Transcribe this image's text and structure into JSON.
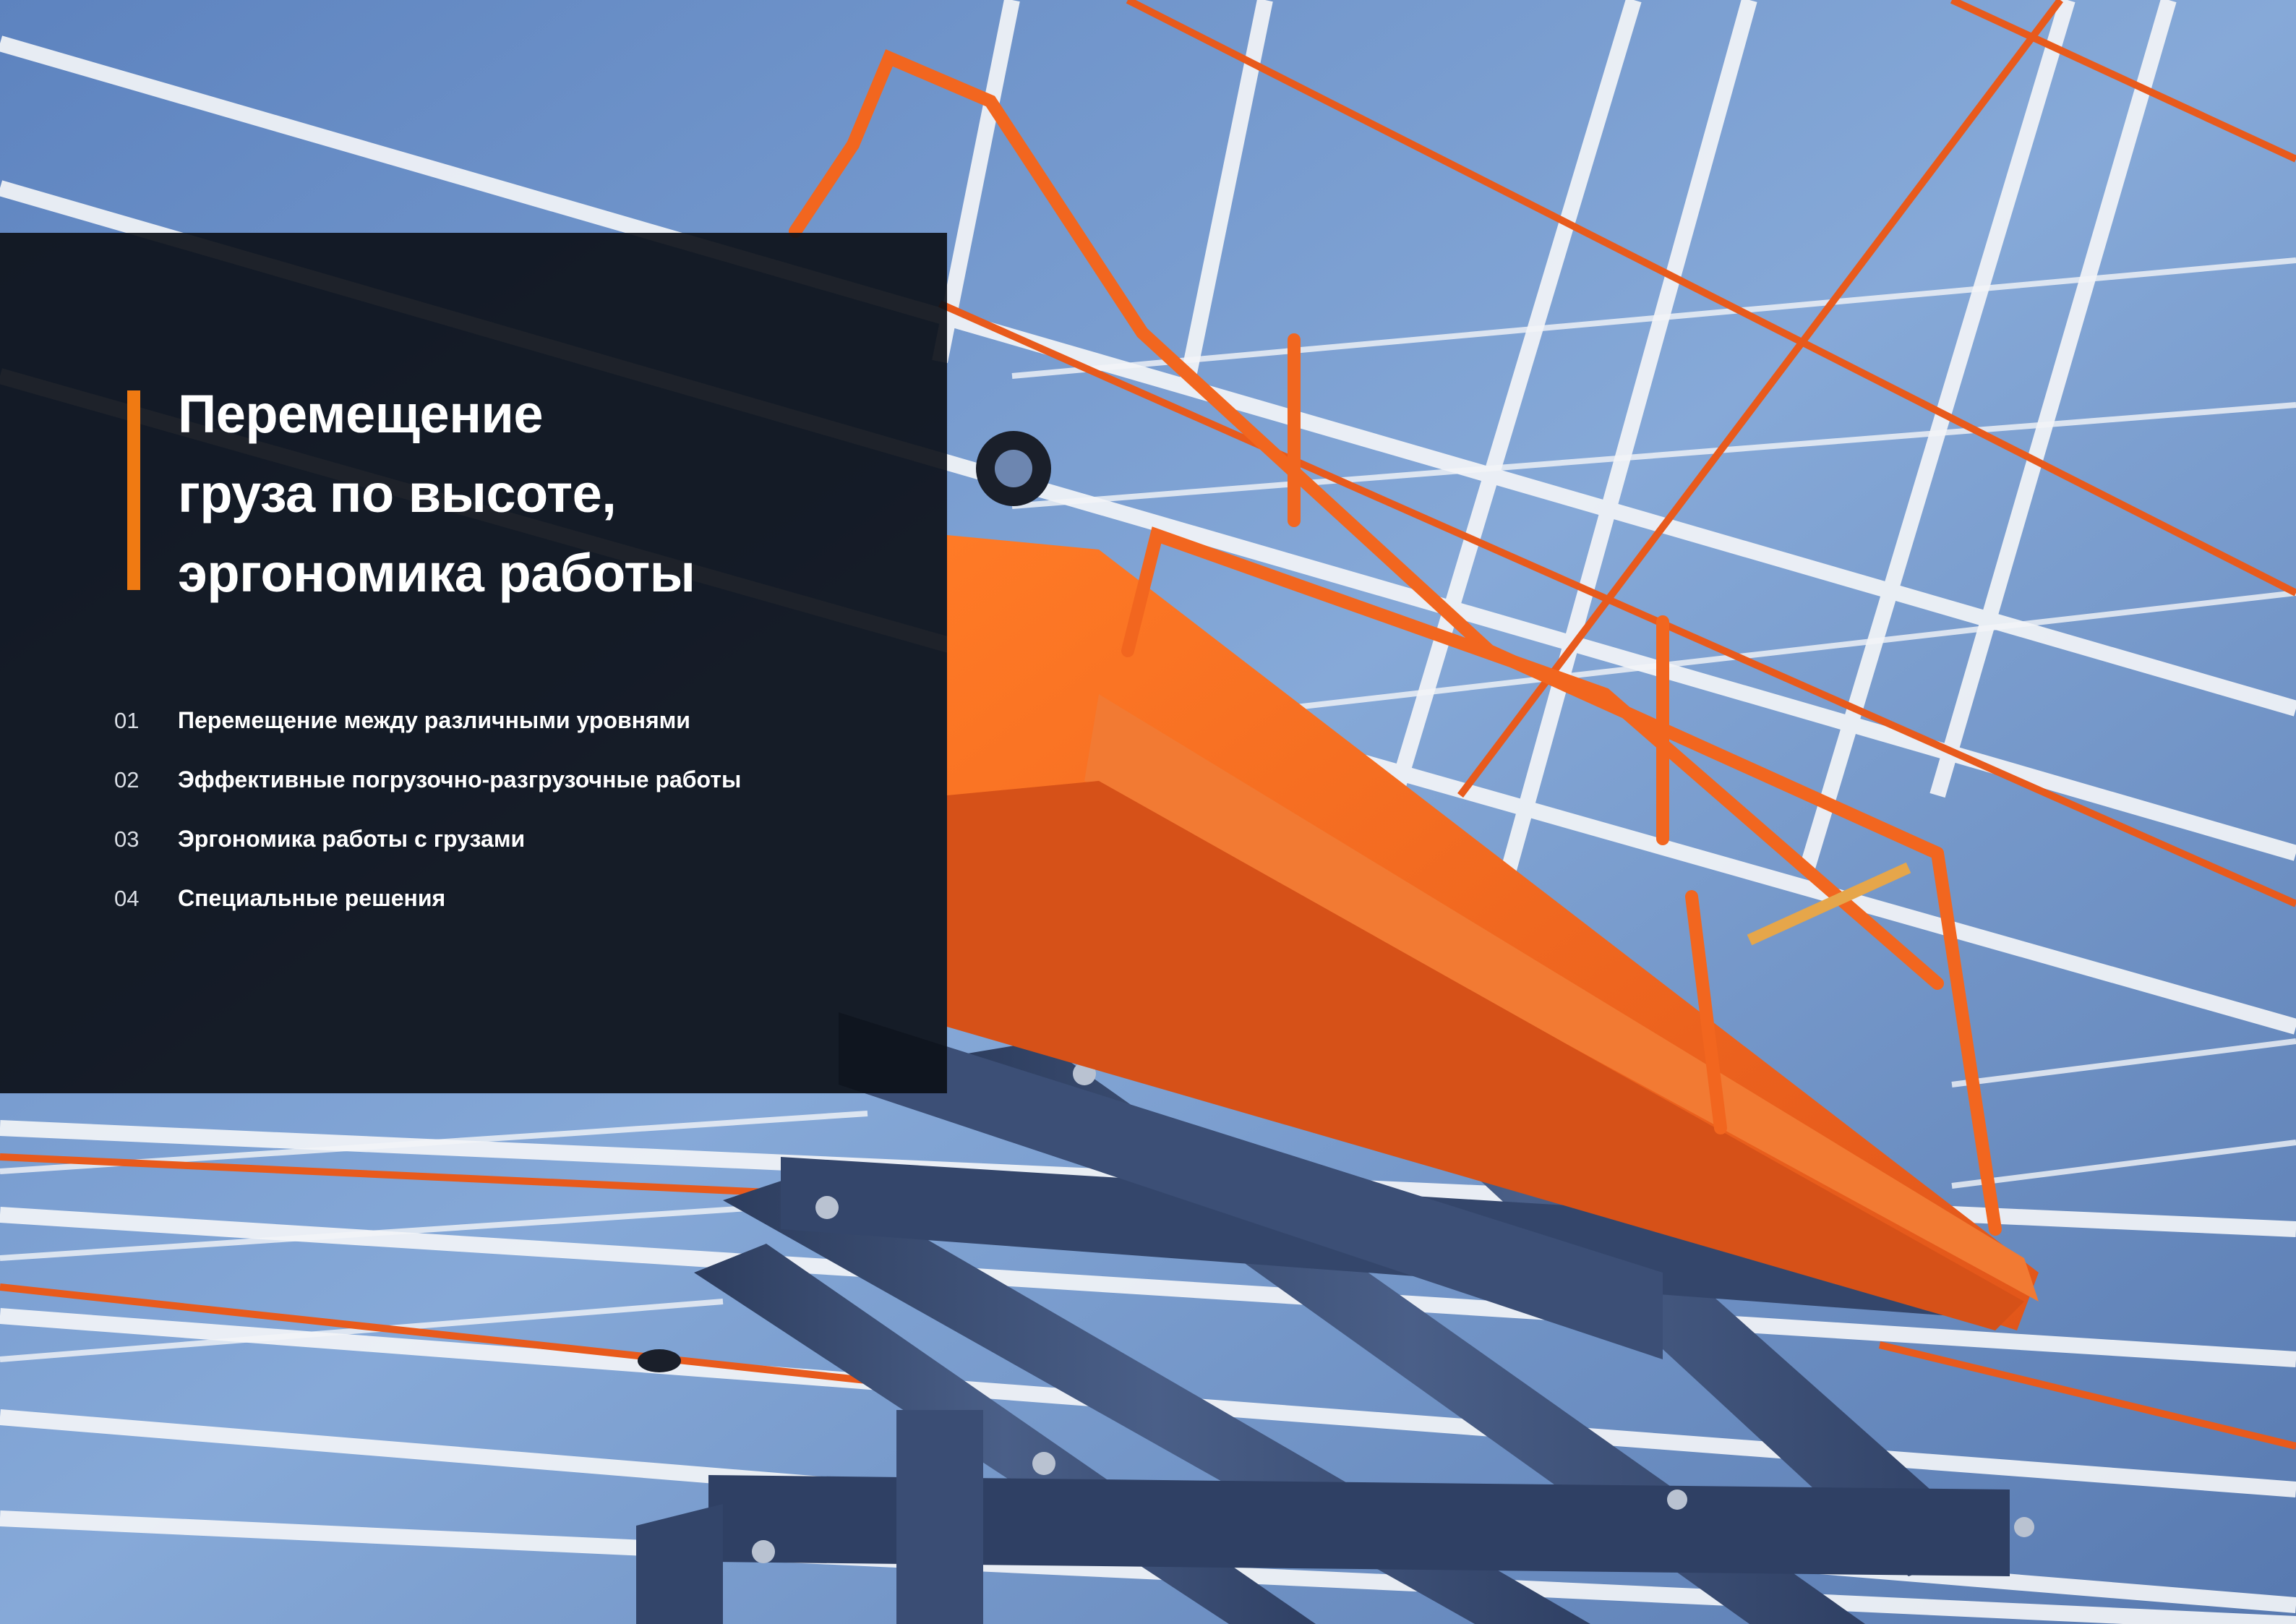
{
  "title_lines": [
    "Перемещение",
    "груза по высоте,",
    "эргономика работы"
  ],
  "contents": [
    {
      "num": "01",
      "label": "Перемещение между различными уровнями"
    },
    {
      "num": "02",
      "label": "Эффективные погрузочно-разгрузочные работы"
    },
    {
      "num": "03",
      "label": "Эргономика работы с грузами"
    },
    {
      "num": "04",
      "label": "Специальные решения"
    }
  ],
  "colors": {
    "accent": "#f07a12",
    "panel": "#0c1018",
    "lift_body": "#f26a1b",
    "lift_scissor": "#3e5277",
    "truss": "#f2f4f7",
    "roof_panel": "#4f76b3"
  },
  "image": {
    "subject": "orange scissor lift under industrial roof trusses"
  }
}
